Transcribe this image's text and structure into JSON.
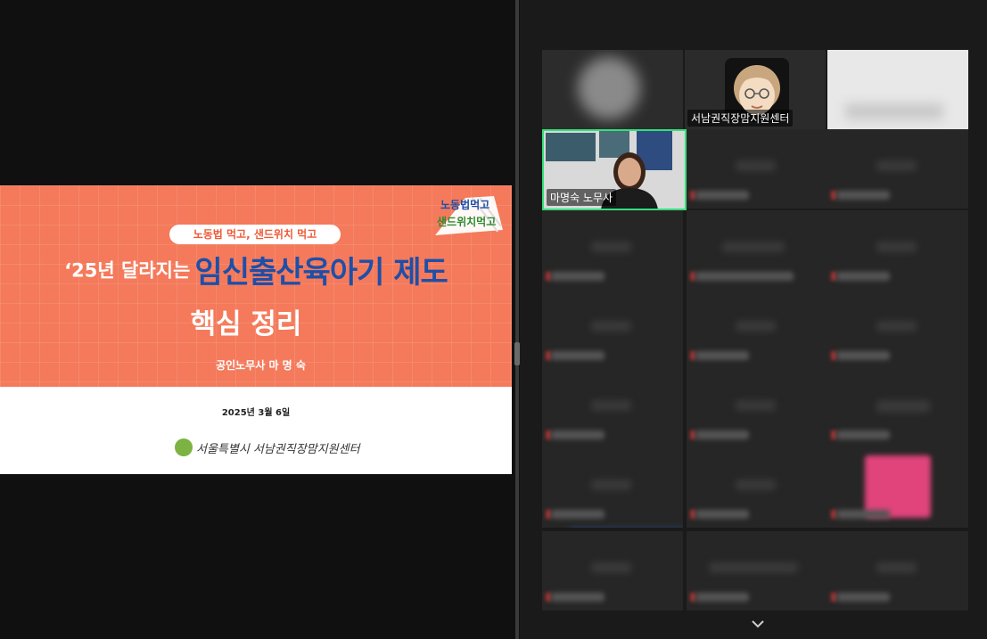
{
  "shared_screen": {
    "slide": {
      "pill_label": "노동법 먹고, 샌드위치 먹고",
      "title_prefix": "‘25년 달라지는",
      "title_highlight": "임신출산육아기 제도",
      "title_line2": "핵심 정리",
      "presenter": "공인노무사  마 명 숙",
      "date": "2025년 3월 6일",
      "org_text": "서울특별시 서남권직장맘지원센터",
      "badge_line1": "노동법먹고",
      "badge_line2": "샌드위치먹고",
      "colors": {
        "top_bg": "#f47a5b",
        "highlight": "#1e4fa8",
        "bottom_bg": "#ffffff"
      }
    }
  },
  "gallery": {
    "participants": [
      {
        "name": "",
        "blurred": true
      },
      {
        "name": "서남권직장맘지원센터",
        "avatar": "avatar-icon",
        "blurred": false
      },
      {
        "name": "",
        "blurred": true
      },
      {
        "name": "마명숙 노무사",
        "speaking": true,
        "blurred": false
      }
    ],
    "active_speaker_color": "#33e07a",
    "scroll_icon": "chevron-down-icon"
  }
}
